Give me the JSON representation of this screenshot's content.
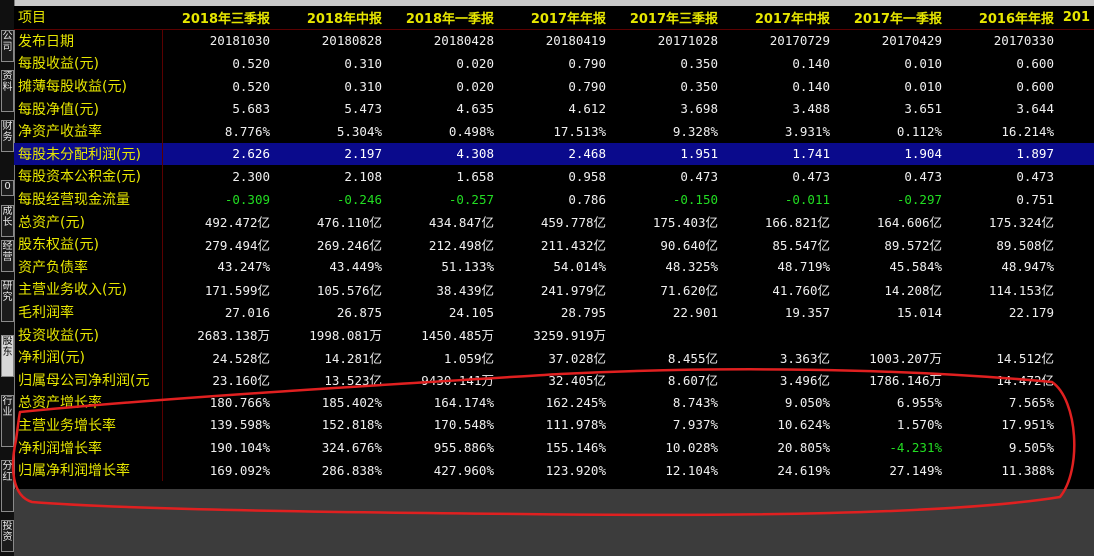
{
  "sidebar": {
    "tabs": [
      "公司",
      "资料",
      "财务",
      "0",
      "成长",
      "经营",
      "研究",
      "股东",
      "行业",
      "分红",
      "投资"
    ],
    "active_index": 7
  },
  "table": {
    "header_label": "项目",
    "columns": [
      "2018年三季报",
      "2018年中报",
      "2018年一季报",
      "2017年年报",
      "2017年三季报",
      "2017年中报",
      "2017年一季报",
      "2016年年报",
      "201"
    ],
    "selected_row": 5,
    "rows": [
      {
        "label": "发布日期",
        "values": [
          "20181030",
          "20180828",
          "20180428",
          "20180419",
          "20171028",
          "20170729",
          "20170429",
          "20170330",
          ""
        ]
      },
      {
        "label": "每股收益(元)",
        "values": [
          "0.520",
          "0.310",
          "0.020",
          "0.790",
          "0.350",
          "0.140",
          "0.010",
          "0.600",
          ""
        ]
      },
      {
        "label": "摊薄每股收益(元)",
        "values": [
          "0.520",
          "0.310",
          "0.020",
          "0.790",
          "0.350",
          "0.140",
          "0.010",
          "0.600",
          ""
        ]
      },
      {
        "label": "每股净值(元)",
        "values": [
          "5.683",
          "5.473",
          "4.635",
          "4.612",
          "3.698",
          "3.488",
          "3.651",
          "3.644",
          ""
        ]
      },
      {
        "label": "净资产收益率",
        "values": [
          "8.776%",
          "5.304%",
          "0.498%",
          "17.513%",
          "9.328%",
          "3.931%",
          "0.112%",
          "16.214%",
          ""
        ]
      },
      {
        "label": "每股未分配利润(元)",
        "values": [
          "2.626",
          "2.197",
          "4.308",
          "2.468",
          "1.951",
          "1.741",
          "1.904",
          "1.897",
          ""
        ]
      },
      {
        "label": "每股资本公积金(元)",
        "values": [
          "2.300",
          "2.108",
          "1.658",
          "0.958",
          "0.473",
          "0.473",
          "0.473",
          "0.473",
          ""
        ]
      },
      {
        "label": "每股经营现金流量",
        "values": [
          "-0.309",
          "-0.246",
          "-0.257",
          "0.786",
          "-0.150",
          "-0.011",
          "-0.297",
          "0.751",
          ""
        ]
      },
      {
        "label": "总资产(元)",
        "values": [
          "492.472亿",
          "476.110亿",
          "434.847亿",
          "459.778亿",
          "175.403亿",
          "166.821亿",
          "164.606亿",
          "175.324亿",
          ""
        ]
      },
      {
        "label": "股东权益(元)",
        "values": [
          "279.494亿",
          "269.246亿",
          "212.498亿",
          "211.432亿",
          "90.640亿",
          "85.547亿",
          "89.572亿",
          "89.508亿",
          ""
        ]
      },
      {
        "label": "资产负债率",
        "values": [
          "43.247%",
          "43.449%",
          "51.133%",
          "54.014%",
          "48.325%",
          "48.719%",
          "45.584%",
          "48.947%",
          ""
        ]
      },
      {
        "label": "主营业务收入(元)",
        "values": [
          "171.599亿",
          "105.576亿",
          "38.439亿",
          "241.979亿",
          "71.620亿",
          "41.760亿",
          "14.208亿",
          "114.153亿",
          ""
        ]
      },
      {
        "label": "毛利润率",
        "values": [
          "27.016",
          "26.875",
          "24.105",
          "28.795",
          "22.901",
          "19.357",
          "15.014",
          "22.179",
          ""
        ]
      },
      {
        "label": "投资收益(元)",
        "values": [
          "2683.138万",
          "1998.081万",
          "1450.485万",
          "3259.919万",
          "",
          "",
          "",
          "",
          ""
        ]
      },
      {
        "label": "净利润(元)",
        "values": [
          "24.528亿",
          "14.281亿",
          "1.059亿",
          "37.028亿",
          "8.455亿",
          "3.363亿",
          "1003.207万",
          "14.512亿",
          ""
        ]
      },
      {
        "label": "归属母公司净利润(元",
        "values": [
          "23.160亿",
          "13.523亿",
          "9430.141万",
          "32.405亿",
          "8.607亿",
          "3.496亿",
          "1786.146万",
          "14.472亿",
          ""
        ]
      },
      {
        "label": "总资产增长率",
        "values": [
          "180.766%",
          "185.402%",
          "164.174%",
          "162.245%",
          "8.743%",
          "9.050%",
          "6.955%",
          "7.565%",
          ""
        ]
      },
      {
        "label": "主营业务增长率",
        "values": [
          "139.598%",
          "152.818%",
          "170.548%",
          "111.978%",
          "7.937%",
          "10.624%",
          "1.570%",
          "17.951%",
          ""
        ]
      },
      {
        "label": "净利润增长率",
        "values": [
          "190.104%",
          "324.676%",
          "955.886%",
          "155.146%",
          "10.028%",
          "20.805%",
          "-4.231%",
          "9.505%",
          ""
        ]
      },
      {
        "label": "归属净利润增长率",
        "values": [
          "169.092%",
          "286.838%",
          "427.960%",
          "123.920%",
          "12.104%",
          "24.619%",
          "27.149%",
          "11.388%",
          ""
        ]
      }
    ]
  },
  "colors": {
    "label": "#e6e600",
    "value": "#f0f0f0",
    "negative": "#22dd22",
    "selected_bg": "#0a0a8c",
    "annotation": "#e02020"
  }
}
